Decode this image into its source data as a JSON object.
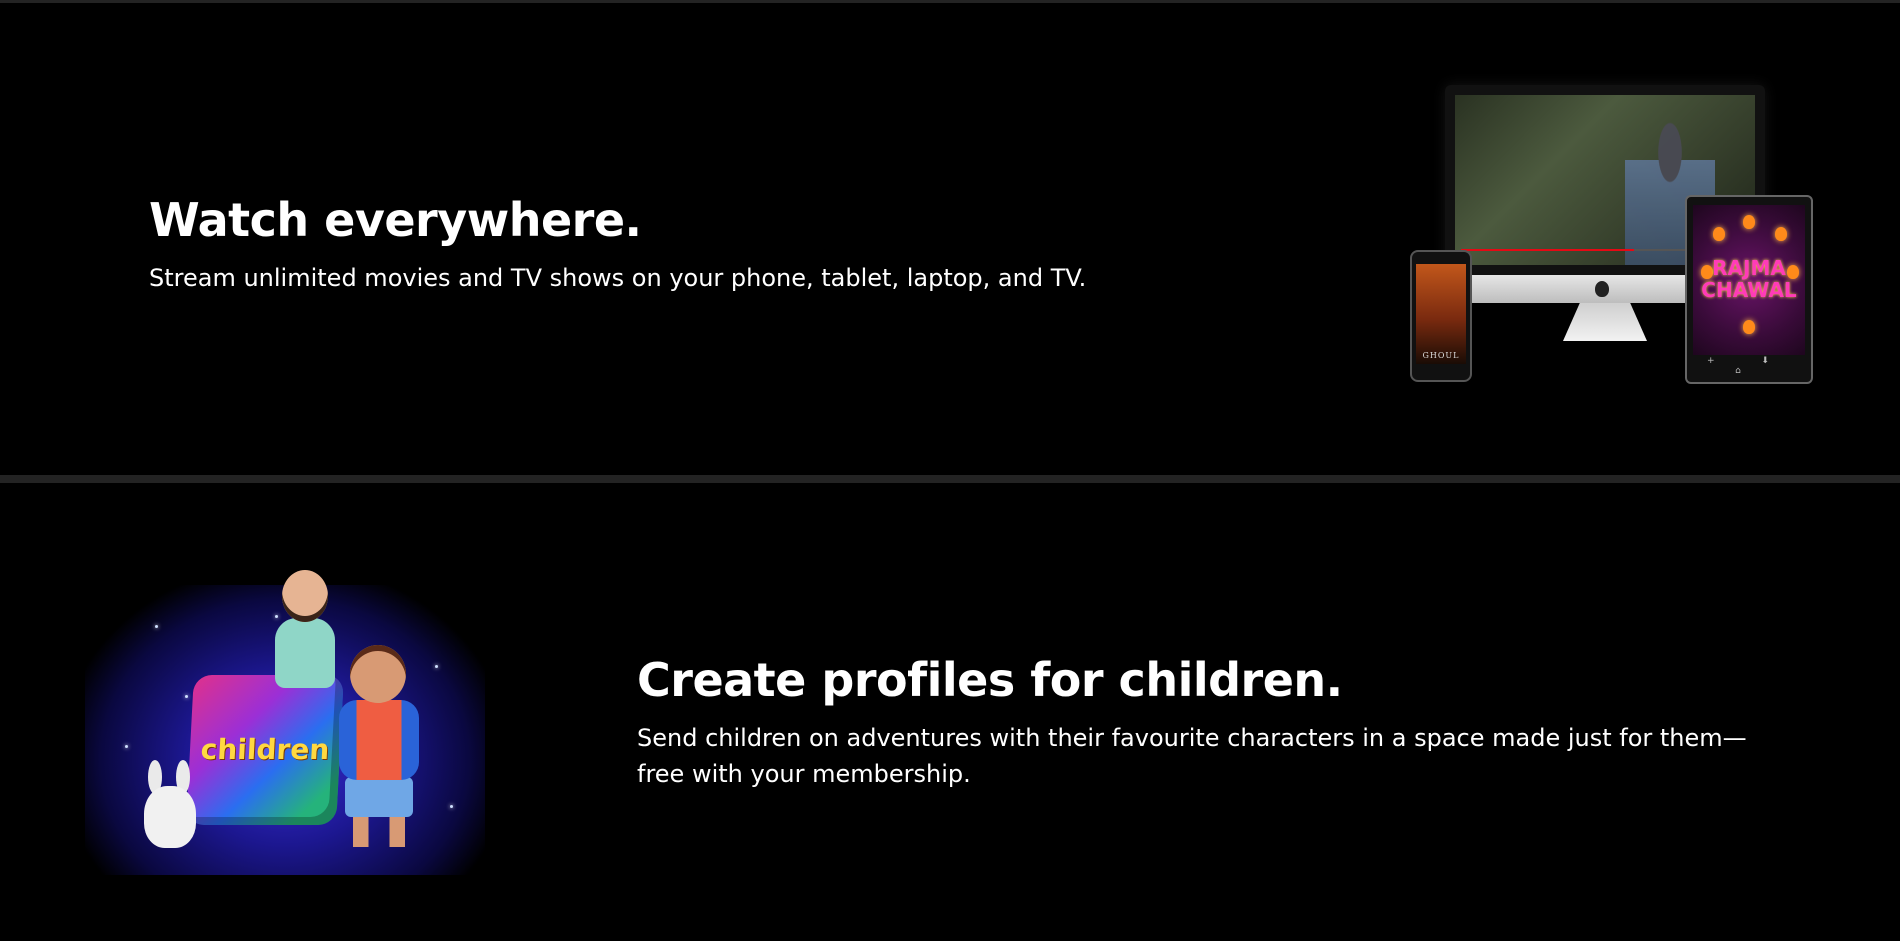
{
  "sections": {
    "watch": {
      "heading": "Watch everywhere.",
      "subtext": "Stream unlimited movies and TV shows on your phone, tablet, laptop, and TV.",
      "devices_image": {
        "phone_title": "GHOUL",
        "tablet_title_line1": "RAJMA",
        "tablet_title_line2": "CHAWAL",
        "progress_fraction": 0.6,
        "tablet_controls": "+ ⬇ ⌂"
      }
    },
    "kids": {
      "heading": "Create profiles for children.",
      "subtext": "Send children on adventures with their favourite characters in a space made just for them—free with your membership.",
      "image_label": "children"
    }
  },
  "colors": {
    "background": "#000000",
    "divider": "#232323",
    "text": "#ffffff",
    "accent_red": "#e50914"
  },
  "icons": [
    "apple-logo-icon"
  ]
}
